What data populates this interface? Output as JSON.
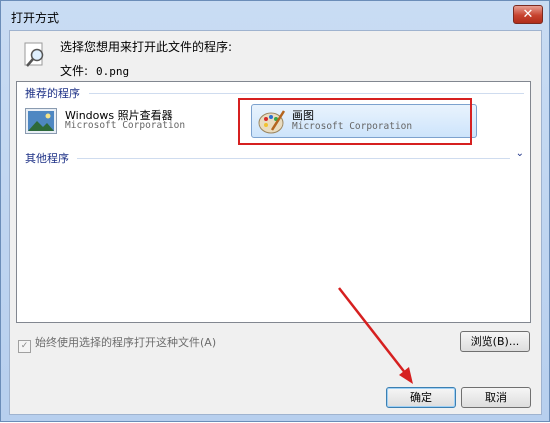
{
  "window": {
    "title": "打开方式",
    "close_label": "✕"
  },
  "header": {
    "instruction": "选择您想用来打开此文件的程序:",
    "file_label": "文件:",
    "file_name": "0.png"
  },
  "groups": {
    "recommended": "推荐的程序",
    "other": "其他程序",
    "other_chevron": "⌄"
  },
  "programs": [
    {
      "name": "Windows 照片查看器",
      "company": "Microsoft Corporation"
    },
    {
      "name": "画图",
      "company": "Microsoft Corporation"
    }
  ],
  "options": {
    "always_use": "始终使用选择的程序打开这种文件(A)",
    "always_checked": true
  },
  "buttons": {
    "browse": "浏览(B)...",
    "ok": "确定",
    "cancel": "取消"
  },
  "colors": {
    "annotation_red": "#d62020",
    "group_header": "#1e3287"
  }
}
